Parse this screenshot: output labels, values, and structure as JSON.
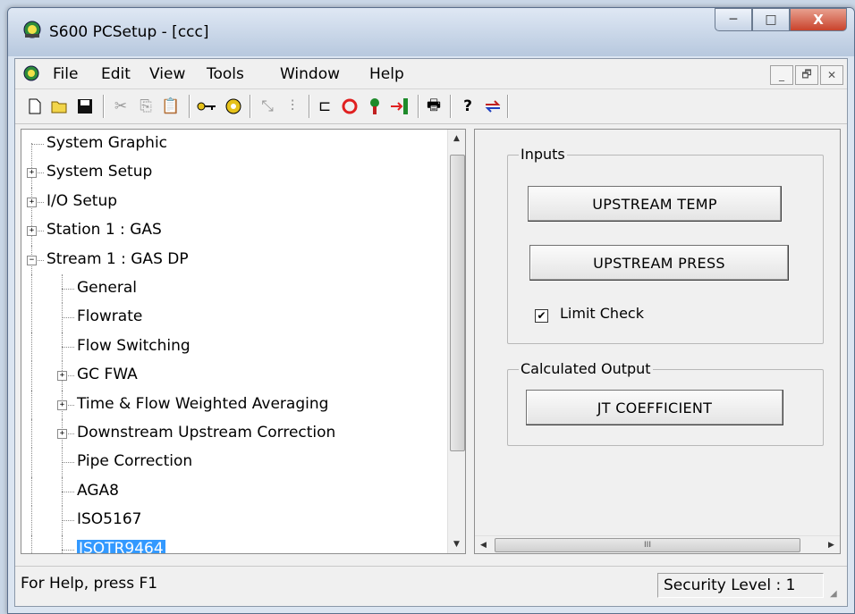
{
  "window": {
    "title": "S600 PCSetup - [ccc]"
  },
  "caption_buttons": {
    "minimize": "─",
    "maximize": "□",
    "close": "X"
  },
  "menu": {
    "items": [
      {
        "label": "File"
      },
      {
        "label": "Edit"
      },
      {
        "label": "View"
      },
      {
        "label": "Tools"
      },
      {
        "label": "Window"
      },
      {
        "label": "Help"
      }
    ],
    "mdi": {
      "minimize": "_",
      "restore": "🗗",
      "close": "✕"
    }
  },
  "toolbar": {
    "icons": [
      "new-icon",
      "open-icon",
      "save-icon",
      "cut-icon",
      "copy-icon",
      "paste-icon",
      "key-icon",
      "key-ring-icon",
      "wand-icon",
      "sliders-icon",
      "plug-icon",
      "circle-icon",
      "pin-icon",
      "transfer-icon",
      "print-icon",
      "help-icon",
      "swap-icon"
    ]
  },
  "tree": {
    "items": [
      {
        "label": "System Graphic",
        "level": 0,
        "expander": ""
      },
      {
        "label": "System Setup",
        "level": 0,
        "expander": "+"
      },
      {
        "label": "I/O Setup",
        "level": 0,
        "expander": "+"
      },
      {
        "label": "Station 1 : GAS",
        "level": 0,
        "expander": "+"
      },
      {
        "label": "Stream 1 : GAS DP",
        "level": 0,
        "expander": "−"
      },
      {
        "label": "General",
        "level": 1,
        "expander": ""
      },
      {
        "label": "Flowrate",
        "level": 1,
        "expander": ""
      },
      {
        "label": "Flow Switching",
        "level": 1,
        "expander": ""
      },
      {
        "label": "GC FWA",
        "level": 1,
        "expander": "+"
      },
      {
        "label": "Time & Flow Weighted Averaging",
        "level": 1,
        "expander": "+"
      },
      {
        "label": "Downstream Upstream Correction",
        "level": 1,
        "expander": "+"
      },
      {
        "label": "Pipe Correction",
        "level": 1,
        "expander": ""
      },
      {
        "label": "AGA8",
        "level": 1,
        "expander": ""
      },
      {
        "label": "ISO5167",
        "level": 1,
        "expander": ""
      },
      {
        "label": "ISOTR9464",
        "level": 1,
        "expander": "",
        "selected": true
      }
    ]
  },
  "panel": {
    "inputs_label": "Inputs",
    "upstream_temp": "UPSTREAM TEMP",
    "upstream_press": "UPSTREAM PRESS",
    "limit_check_label": "Limit Check",
    "limit_check_checked": true,
    "calculated_output_label": "Calculated Output",
    "jt_coefficient": "JT COEFFICIENT"
  },
  "scroll": {
    "hthumb_grip": "III",
    "up": "▲",
    "down": "▼",
    "left": "◀",
    "right": "▶"
  },
  "status": {
    "help": "For Help, press F1",
    "security": "Security Level : 1"
  }
}
